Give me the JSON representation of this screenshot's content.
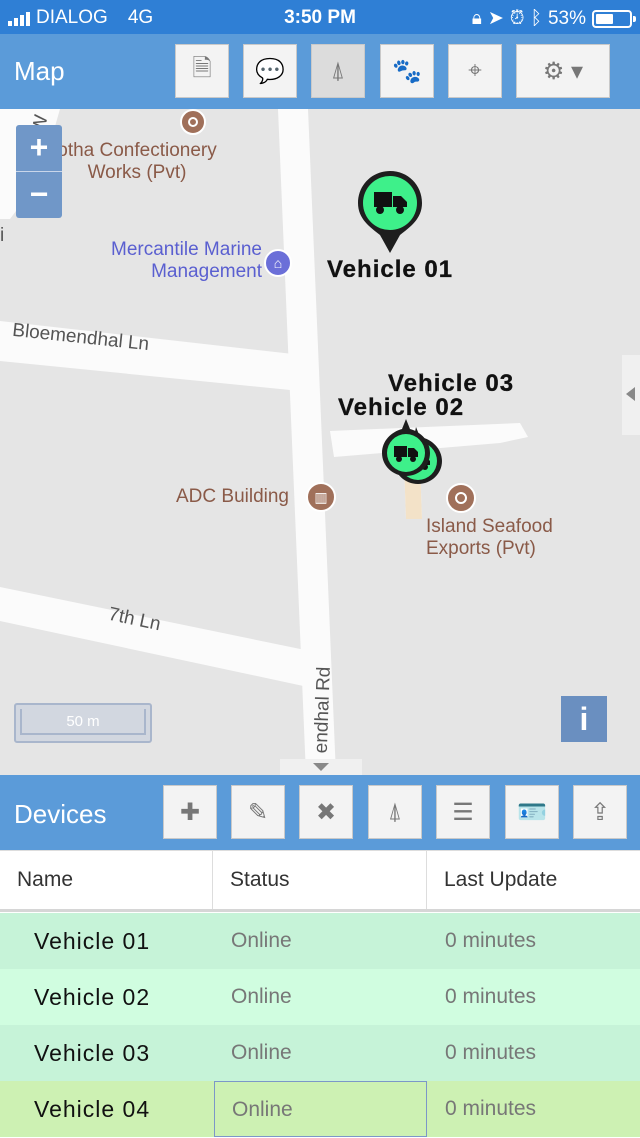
{
  "status_bar": {
    "carrier": "DIALOG",
    "network": "4G",
    "time": "3:50 PM",
    "battery": "53%",
    "battery_level": 0.53,
    "icons": [
      "signal-icon",
      "rotation-lock-icon",
      "location-arrow-icon",
      "alarm-icon",
      "bluetooth-icon",
      "battery-icon"
    ]
  },
  "map_panel": {
    "title": "Map",
    "toolbar": [
      {
        "name": "report-button",
        "icon": "document-icon",
        "glyph": "🗎",
        "active": false
      },
      {
        "name": "messages-button",
        "icon": "chat-icon",
        "glyph": "💬",
        "active": false
      },
      {
        "name": "follow-button",
        "icon": "person-pin-icon",
        "glyph": "⍋",
        "active": true
      },
      {
        "name": "geofence-button",
        "icon": "paw-icon",
        "glyph": "🐾",
        "active": false
      },
      {
        "name": "locate-button",
        "icon": "crosshair-icon",
        "glyph": "⌖",
        "active": false
      },
      {
        "name": "settings-button",
        "icon": "gear-icon",
        "glyph": "⚙ ▾",
        "active": false
      }
    ],
    "zoom_in": "+",
    "zoom_out": "−",
    "scale": "50 m",
    "info": "i",
    "streets": {
      "bloemendhal_ln": "Bloemendhal Ln",
      "seventh_ln": "7th Ln",
      "bloemendhal_rd": "endhal Rd",
      "partial_w": "W",
      "partial_i": "i"
    },
    "pois": {
      "confectionery_line1": "otha Confectionery",
      "confectionery_line2": "Works (Pvt)",
      "mercantile_line1": "Mercantile Marine",
      "mercantile_line2": "Management",
      "adc": "ADC Building",
      "seafood_line1": "Island Seafood",
      "seafood_line2": "Exports (Pvt)"
    },
    "vehicle_markers": {
      "v1": "Vehicle 01",
      "v2": "Vehicle 02",
      "v3": "Vehicle 03"
    },
    "colors": {
      "marker_fill": "#3ef08a",
      "poi_brown": "#a0705a",
      "poi_blue": "#6b6fd8"
    }
  },
  "devices_panel": {
    "title": "Devices",
    "toolbar": [
      {
        "name": "add-device-button",
        "icon": "plus-icon",
        "glyph": "✚"
      },
      {
        "name": "edit-device-button",
        "icon": "pencil-icon",
        "glyph": "✎"
      },
      {
        "name": "remove-device-button",
        "icon": "close-icon",
        "glyph": "✖"
      },
      {
        "name": "device-follow-button",
        "icon": "person-pin-icon",
        "glyph": "⍋"
      },
      {
        "name": "device-list-button",
        "icon": "list-icon",
        "glyph": "☰"
      },
      {
        "name": "device-info-button",
        "icon": "id-card-icon",
        "glyph": "🪪"
      },
      {
        "name": "device-upload-button",
        "icon": "upload-icon",
        "glyph": "⇪"
      }
    ],
    "columns": [
      "Name",
      "Status",
      "Last Update"
    ],
    "rows": [
      {
        "name": "Vehicle 01",
        "status": "Online",
        "last_update": "0 minutes",
        "color": "#c6f3d8"
      },
      {
        "name": "Vehicle 02",
        "status": "Online",
        "last_update": "0 minutes",
        "color": "#d0fde0"
      },
      {
        "name": "Vehicle 03",
        "status": "Online",
        "last_update": "0 minutes",
        "color": "#c6f3d8"
      },
      {
        "name": "Vehicle 04",
        "status": "Online",
        "last_update": "0 minutes",
        "color": "#cdf1b3"
      }
    ]
  }
}
